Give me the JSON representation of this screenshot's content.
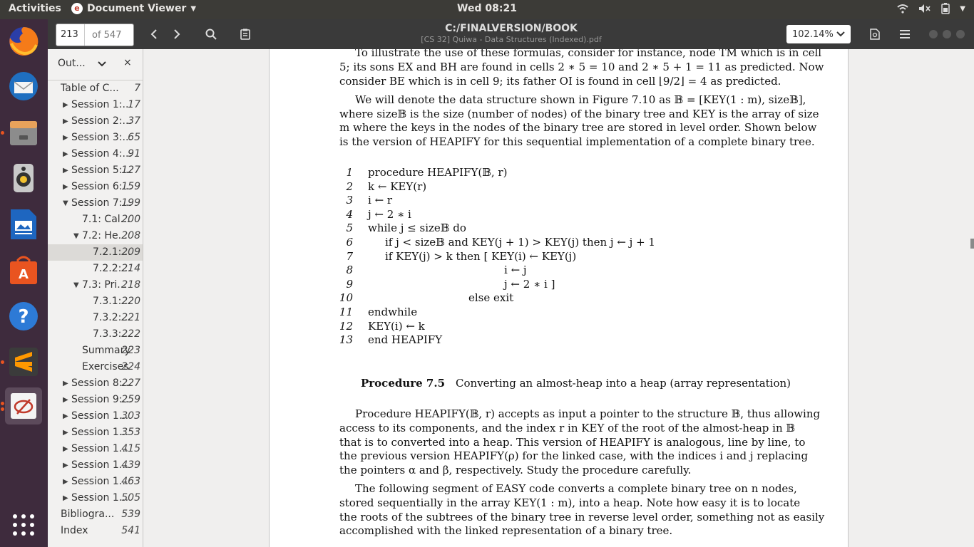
{
  "topbar": {
    "activities": "Activities",
    "app_name": "Document Viewer",
    "clock": "Wed 08:21"
  },
  "header": {
    "page_current": "213",
    "page_total": "of 547",
    "doc_title": "C:/FINALVERSION/BOOK",
    "doc_subtitle": "[CS 32] Quiwa - Data Structures (Indexed).pdf",
    "zoom": "102.14%"
  },
  "sidebar": {
    "title": "Out...",
    "items": [
      {
        "label": "Table of C...",
        "page": "7"
      },
      {
        "label": "Session 1:...",
        "page": "17"
      },
      {
        "label": "Session 2:...",
        "page": "37"
      },
      {
        "label": "Session 3:...",
        "page": "65"
      },
      {
        "label": "Session 4:...",
        "page": "91"
      },
      {
        "label": "Session 5:...",
        "page": "127"
      },
      {
        "label": "Session 6:...",
        "page": "159"
      },
      {
        "label": "Session 7:...",
        "page": "199"
      },
      {
        "label": "7.1: Cal...",
        "page": "200"
      },
      {
        "label": "7.2: He...",
        "page": "208"
      },
      {
        "label": "7.2.1:...",
        "page": "209"
      },
      {
        "label": "7.2.2:...",
        "page": "214"
      },
      {
        "label": "7.3: Pri...",
        "page": "218"
      },
      {
        "label": "7.3.1:...",
        "page": "220"
      },
      {
        "label": "7.3.2:...",
        "page": "221"
      },
      {
        "label": "7.3.3:...",
        "page": "222"
      },
      {
        "label": "Summary",
        "page": "223"
      },
      {
        "label": "Exercises",
        "page": "224"
      },
      {
        "label": "Session 8:...",
        "page": "227"
      },
      {
        "label": "Session 9:...",
        "page": "259"
      },
      {
        "label": "Session 1...",
        "page": "303"
      },
      {
        "label": "Session 1...",
        "page": "353"
      },
      {
        "label": "Session 1...",
        "page": "415"
      },
      {
        "label": "Session 1...",
        "page": "439"
      },
      {
        "label": "Session 1...",
        "page": "463"
      },
      {
        "label": "Session 1...",
        "page": "505"
      },
      {
        "label": "Bibliogra...",
        "page": "539"
      },
      {
        "label": "Index",
        "page": "541"
      }
    ]
  },
  "document": {
    "para1": [
      "To illustrate the use of these formulas, consider for instance, node TM which is in cell",
      "5; its sons EX and BH are found in cells 2 ∗ 5 = 10 and 2 ∗ 5 + 1 = 11 as predicted. Now",
      "consider BE which is in cell 9; its father OI is found in cell ⌊9/2⌋ = 4 as predicted."
    ],
    "para2": [
      "We will denote the data structure shown in Figure 7.10 as 𝔹 = [KEY(1 : m), size𝔹],",
      "where size𝔹 is the size (number of nodes) of the binary tree and KEY is the array of size",
      "m where the keys in the nodes of the binary tree are stored in level order. Shown below",
      "is the version of HEAPIFY for this sequential implementation of a complete binary tree."
    ],
    "code": [
      {
        "n": "1",
        "text": "procedure HEAPIFY(𝔹, r)"
      },
      {
        "n": "2",
        "text": "k ← KEY(r)"
      },
      {
        "n": "3",
        "text": "i ← r"
      },
      {
        "n": "4",
        "text": "j ← 2 ∗ i"
      },
      {
        "n": "5",
        "text": "while j ≤ size𝔹 do"
      },
      {
        "n": "6",
        "text": "if j < size𝔹 and KEY(j + 1) > KEY(j) then j ← j + 1"
      },
      {
        "n": "7",
        "text": "if KEY(j) > k then [ KEY(i) ← KEY(j)"
      },
      {
        "n": "8",
        "text": "i ← j"
      },
      {
        "n": "9",
        "text": "j ← 2 ∗ i ]"
      },
      {
        "n": "10",
        "text": "else exit"
      },
      {
        "n": "11",
        "text": "endwhile"
      },
      {
        "n": "12",
        "text": "KEY(i) ← k"
      },
      {
        "n": "13",
        "text": "end HEAPIFY"
      }
    ],
    "caption_label": "Procedure 7.5",
    "caption_text": "Converting an almost-heap into a heap (array representation)",
    "para3": [
      "Procedure HEAPIFY(𝔹, r) accepts as input a pointer to the structure 𝔹, thus allowing",
      "access to its components, and the index r in KEY of the root of the almost-heap in 𝔹",
      "that is to converted into a heap. This version of HEAPIFY is analogous, line by line, to",
      "the previous version HEAPIFY(ρ) for the linked case, with the indices i and j replacing",
      "the pointers α and β, respectively. Study the procedure carefully."
    ],
    "para4": [
      "The following segment of EASY code converts a complete binary tree on n nodes,",
      "stored sequentially in the array KEY(1 : m), into a heap. Note how easy it is to locate",
      "the roots of the subtrees of the binary tree in reverse level order, something not as easily",
      "accomplished with the linked representation of a binary tree."
    ]
  }
}
